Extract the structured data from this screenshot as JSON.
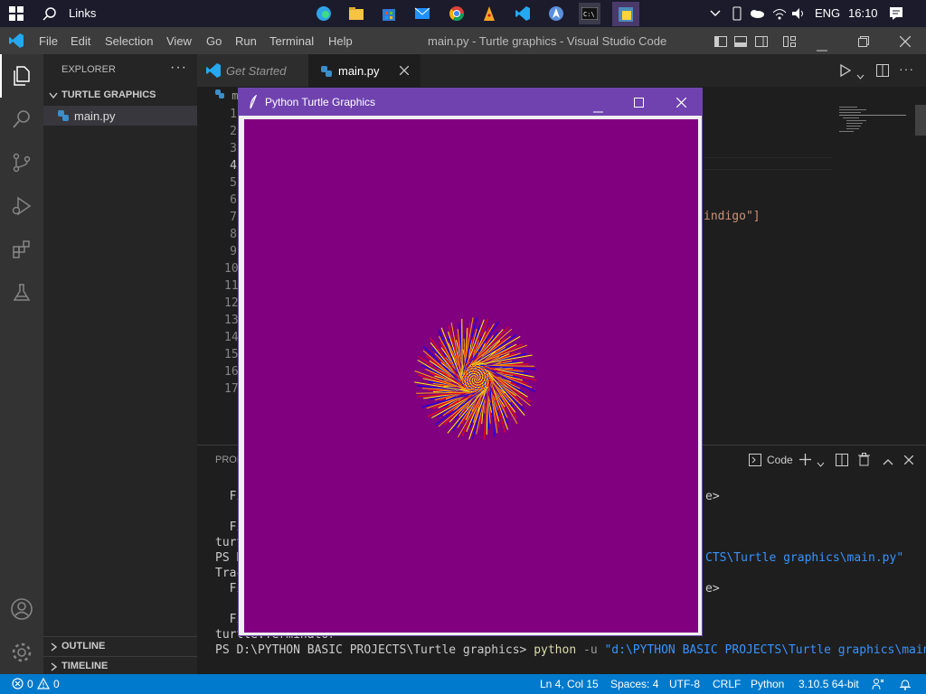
{
  "taskbar": {
    "search_text": "Links",
    "language": "ENG",
    "time": "16:10"
  },
  "menubar": {
    "items": [
      "File",
      "Edit",
      "Selection",
      "View",
      "Go",
      "Run",
      "Terminal",
      "Help"
    ],
    "window_title": "main.py - Turtle graphics - Visual Studio Code"
  },
  "explorer": {
    "title": "EXPLORER",
    "folder": "TURTLE GRAPHICS",
    "file": "main.py",
    "outline": "OUTLINE",
    "timeline": "TIMELINE"
  },
  "tabs": [
    {
      "label": "Get Started"
    },
    {
      "label": "main.py"
    }
  ],
  "editor": {
    "line_numbers": [
      "1",
      "2",
      "3",
      "4",
      "5",
      "6",
      "7",
      "8",
      "9",
      "10",
      "11",
      "12",
      "13",
      "14",
      "15",
      "16",
      "17"
    ],
    "visible_code_fragment": "indigo\"]",
    "breadcrumb_fragment": "m"
  },
  "panel": {
    "tab_fragment": "PROB",
    "terminal_profile": "Code",
    "lines": [
      {
        "text": "  Fi",
        "right": "e>"
      },
      {
        "text": "  Fi",
        "right": ""
      },
      {
        "text": "turt",
        "right": ""
      },
      {
        "text": "PS D",
        "right": "CTS\\Turtle graphics\\main.py\""
      },
      {
        "text": "Trac",
        "right": ""
      },
      {
        "text": "  Fi",
        "right": "e>"
      },
      {
        "text": "  Fi",
        "right": ""
      },
      {
        "text": "turtle.Terminator",
        "right": ""
      }
    ],
    "prompt": "PS D:\\PYTHON BASIC PROJECTS\\Turtle graphics>",
    "cmd": "python",
    "flag": "-u",
    "arg": "\"d:\\PYTHON BASIC PROJECTS\\Turtle graphics\\main.py\""
  },
  "turtle_window": {
    "title": "Python Turtle Graphics",
    "bg_color": "#800080",
    "pattern_colors": [
      "#ff0000",
      "#ffff00",
      "#0000ff",
      "#ffa500"
    ]
  },
  "status": {
    "errors": "0",
    "warnings": "0",
    "position": "Ln 4, Col 15",
    "spaces": "Spaces: 4",
    "encoding": "UTF-8",
    "eol": "CRLF",
    "language": "Python",
    "interpreter": "3.10.5 64-bit"
  },
  "colors": {
    "accent": "#007acc",
    "string": "#ce9178",
    "keyword": "#dcdcaa",
    "path": "#3794ff"
  }
}
